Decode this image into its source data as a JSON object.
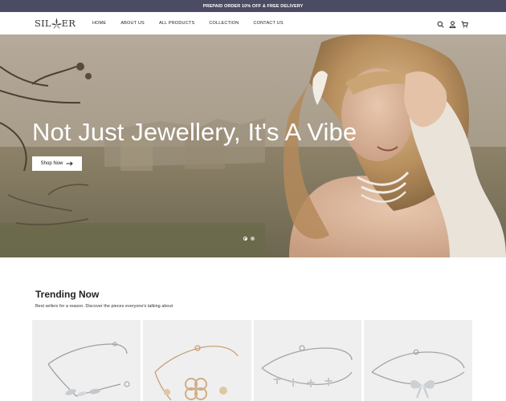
{
  "announcement": "PREPAID ORDER 10% OFF & FREE DELIVERY",
  "brand": {
    "logo_text_left": "SIL",
    "logo_text_right": "ER"
  },
  "nav": {
    "items": [
      "HOME",
      "ABOUT US",
      "ALL PRODUCTS",
      "COLLECTION",
      "CONTACT US"
    ]
  },
  "header_icons": [
    "search-icon",
    "user-icon",
    "cart-icon"
  ],
  "cart": {
    "count": "0"
  },
  "hero": {
    "title": "Not Just Jewellery, It's A Vibe",
    "button_label": "Shop Now",
    "button_icon": "arrow-right-icon",
    "slides": 2,
    "active_slide": 1
  },
  "trending": {
    "title": "Trending Now",
    "subtitle": "Best sellers for a reason. Discover the pieces everyone's talking about"
  },
  "products": [
    {
      "image": "silver leaf bracelet"
    },
    {
      "image": "rose gold clover bracelet"
    },
    {
      "image": "silver cross bracelet"
    },
    {
      "image": "silver bow bracelet"
    }
  ],
  "colors": {
    "announcement_bg": "#4b4b63",
    "product_bg": "#efefef",
    "accent": "#111111"
  }
}
